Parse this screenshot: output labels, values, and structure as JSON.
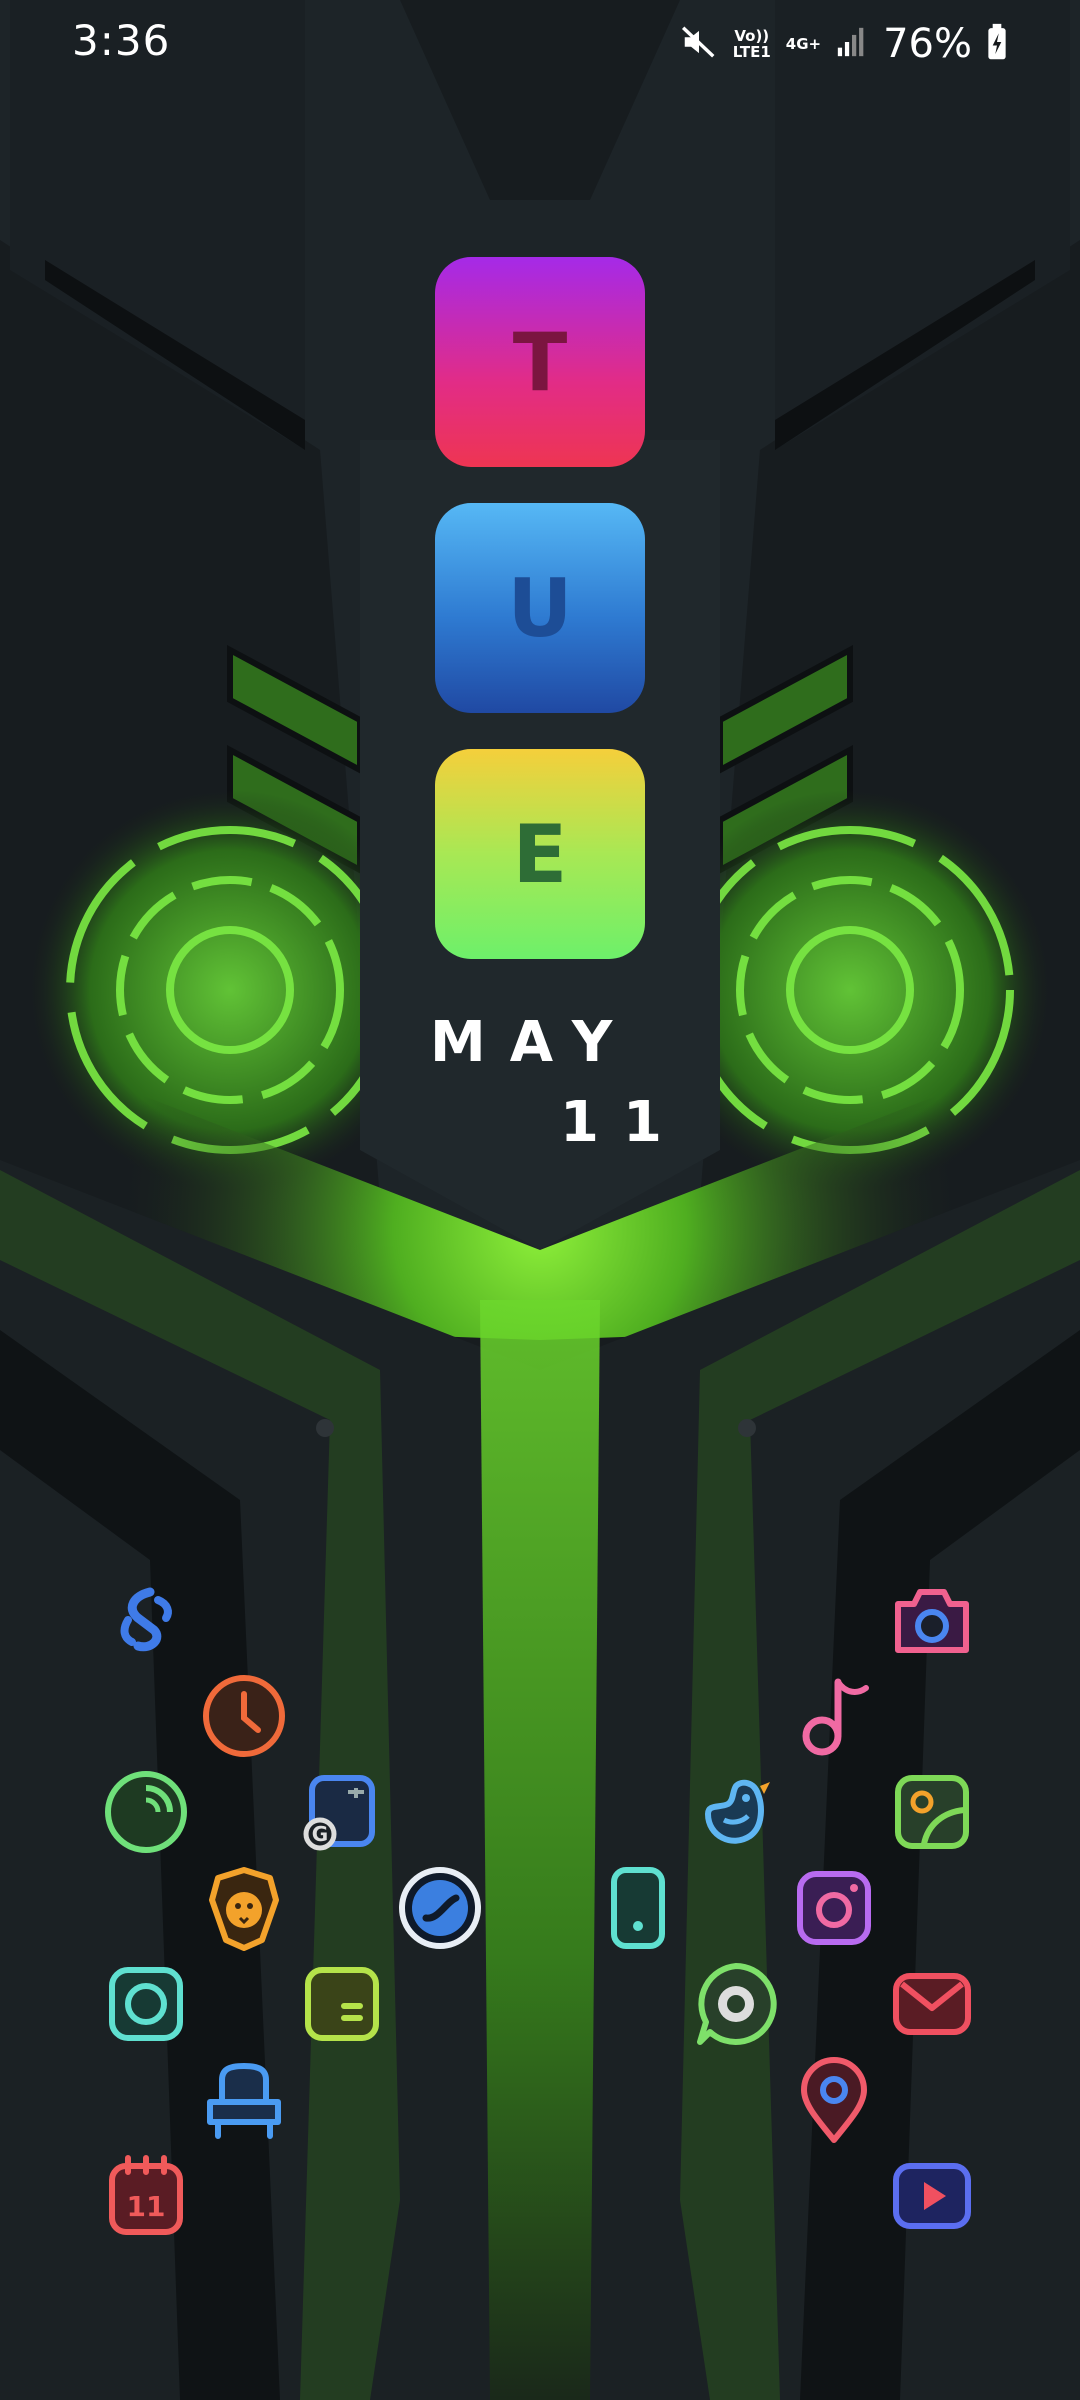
{
  "status_bar": {
    "time": "3:36",
    "volte_label": "Vo)) LTE1",
    "network_label": "4G+",
    "battery": "76%",
    "icons": [
      "mute-icon",
      "signal-icon",
      "battery-charging-icon"
    ]
  },
  "widget": {
    "day_letters": [
      "T",
      "U",
      "E"
    ],
    "month": "MAY",
    "day": "11"
  },
  "apps": [
    {
      "name": "shazam",
      "icon": "shazam-icon",
      "color": "#3f7be8"
    },
    {
      "name": "clock",
      "icon": "clock-icon",
      "color": "#f06a3a"
    },
    {
      "name": "phone-manager",
      "icon": "gauge-icon",
      "color": "#6fe07a"
    },
    {
      "name": "translate",
      "icon": "translate-icon",
      "color": "#4a86f0"
    },
    {
      "name": "brave",
      "icon": "lion-icon",
      "color": "#f3a22b"
    },
    {
      "name": "browser",
      "icon": "browser-icon",
      "color": "#3b7fe0"
    },
    {
      "name": "screen-recorder",
      "icon": "record-icon",
      "color": "#5fe0d0"
    },
    {
      "name": "notes",
      "icon": "notes-icon",
      "color": "#b5e34a"
    },
    {
      "name": "themes",
      "icon": "chair-icon",
      "color": "#4a9bf2"
    },
    {
      "name": "calendar",
      "icon": "calendar-icon",
      "color": "#f05a5a",
      "label": "11"
    },
    {
      "name": "camera",
      "icon": "camera-icon",
      "color": "#f0618f"
    },
    {
      "name": "music",
      "icon": "music-note-icon",
      "color": "#f06aa3"
    },
    {
      "name": "gallery",
      "icon": "gallery-icon",
      "color": "#7ed957"
    },
    {
      "name": "twitter",
      "icon": "bird-icon",
      "color": "#5fb6f2"
    },
    {
      "name": "instagram",
      "icon": "instagram-icon",
      "color": "#b86bf0"
    },
    {
      "name": "phone",
      "icon": "phone-icon",
      "color": "#56e0c0"
    },
    {
      "name": "whatsapp",
      "icon": "chat-icon",
      "color": "#7ee06a"
    },
    {
      "name": "mail",
      "icon": "mail-icon",
      "color": "#f05060"
    },
    {
      "name": "maps",
      "icon": "location-pin-icon",
      "color": "#f05a6a"
    },
    {
      "name": "youtube",
      "icon": "youtube-icon",
      "color": "#5b6ef0"
    }
  ]
}
